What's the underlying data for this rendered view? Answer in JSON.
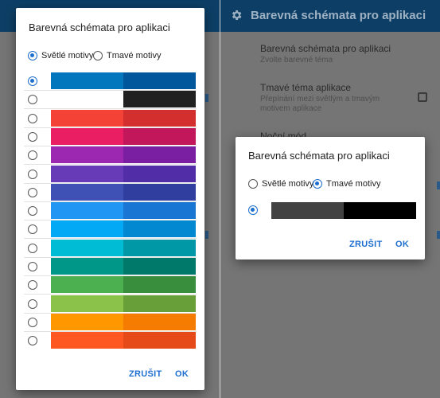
{
  "app_title": "Barevná schémata pro aplikaci",
  "colors": {
    "accent": "#1E6FCF",
    "appbar": "#0D3F66"
  },
  "settings": {
    "color_scheme_title": "Barevná schémata pro aplikaci",
    "color_scheme_sub": "Zvolte barevné téma",
    "dark_theme_title": "Tmavé téma aplikace",
    "dark_theme_sub": "Přepínání mezi světlým a tmavým motivem aplikace",
    "night_mode_title": "Noční mód"
  },
  "dialog_light": {
    "title": "Barevná schémata pro aplikaci",
    "radio_light": "Světlé motivy",
    "radio_dark": "Tmavé motivy",
    "selected_mode": "light",
    "selected_index": 0,
    "swatches": [
      [
        "#0277BD",
        "#01579B"
      ],
      [
        "#FFFFFF",
        "#212121"
      ],
      [
        "#F44336",
        "#D32F2F"
      ],
      [
        "#E91E63",
        "#C2185B"
      ],
      [
        "#9C27B0",
        "#7B1FA2"
      ],
      [
        "#673AB7",
        "#512DA8"
      ],
      [
        "#3F51B5",
        "#303F9F"
      ],
      [
        "#2196F3",
        "#1976D2"
      ],
      [
        "#03A9F4",
        "#0288D1"
      ],
      [
        "#00BCD4",
        "#0097A7"
      ],
      [
        "#009688",
        "#00796B"
      ],
      [
        "#4CAF50",
        "#388E3C"
      ],
      [
        "#8BC34A",
        "#689F38"
      ],
      [
        "#FF9800",
        "#F57C00"
      ],
      [
        "#FF5722",
        "#E64A19"
      ]
    ],
    "cancel": "ZRUŠIT",
    "ok": "OK"
  },
  "dialog_dark": {
    "title": "Barevná schémata pro aplikaci",
    "radio_light": "Světlé motivy",
    "radio_dark": "Tmavé motivy",
    "selected_mode": "dark",
    "swatches": [
      [
        "#424242",
        "#000000"
      ]
    ],
    "cancel": "ZRUŠIT",
    "ok": "OK"
  }
}
